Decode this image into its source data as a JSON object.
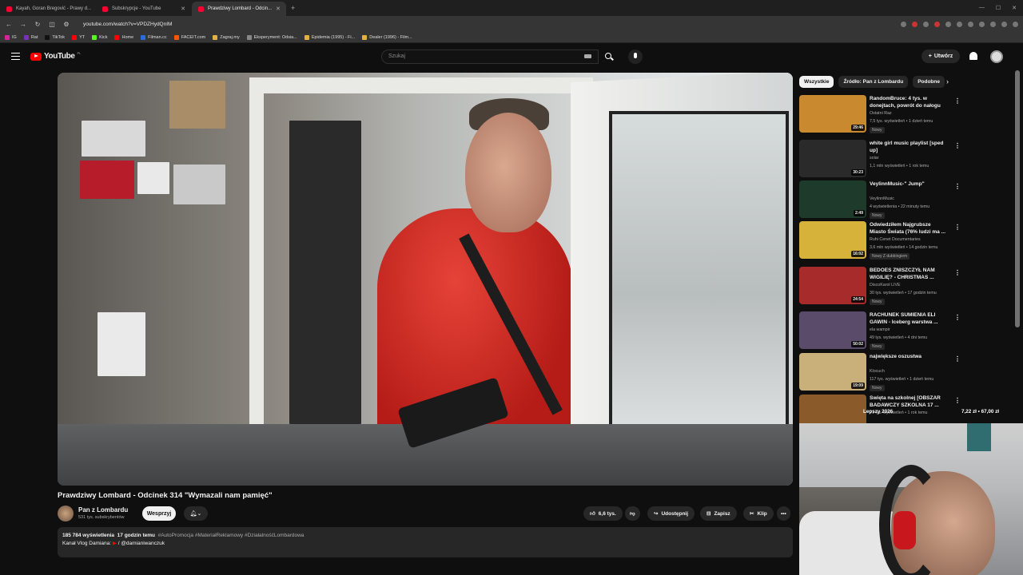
{
  "browser": {
    "tabs": [
      {
        "label": "Kayah, Goran Bregović - Prawy d...",
        "active": false
      },
      {
        "label": "Subskrypcje - YouTube",
        "active": false
      },
      {
        "label": "Prawdziwy Lombard - Odcin...",
        "active": true
      }
    ],
    "url": "youtube.com/watch?v=VPDZHydQnIM",
    "bookmarks": [
      "IG",
      "Rat",
      "TikTok",
      "YT",
      "Kick",
      "Home",
      "Filman.cc",
      "FACEIT.com",
      "Zagraj.my",
      "Eksperyment: Odsia...",
      "Epidemia (1995) - Fi...",
      "Dealer (1996) - Film..."
    ]
  },
  "header": {
    "logo_text": "YouTube",
    "logo_country": "PL",
    "search_placeholder": "Szukaj",
    "create_label": "Utwórz"
  },
  "video": {
    "title": "Prawdziwy Lombard - Odcinek 314 \"Wymazali nam pamięć\"",
    "channel": "Pan z Lombardu",
    "subscribers": "531 tys. subskrybentów",
    "support_label": "Wesprzyj",
    "likes": "6,6 tys.",
    "share_label": "Udostępnij",
    "save_label": "Zapisz",
    "clip_label": "Klip",
    "views": "185 784 wyświetlenia",
    "time_ago": "17 godzin temu",
    "hashtags": "#AutoPromocja #MateriałReklamowy #DziałalnośćLombardowa",
    "desc_line2_prefix": "Kanał Vlog Damiana:",
    "desc_line2_handle": "/ @damianiwanczuk"
  },
  "sidebar": {
    "chips": [
      "Wszystkie",
      "Źródło: Pan z Lombardu",
      "Podobne"
    ],
    "recommendations": [
      {
        "title": "RandomBruce: 4 tys. w donejtach, powrót do nałogu",
        "channel": "Ostatni Raz",
        "meta": "7,5 tys. wyświetleń • 1 dzień temu",
        "badge": "Nowy",
        "duration": "29:46",
        "thumb_color": "#c98a2f"
      },
      {
        "title": "white girl music playlist [sped up]",
        "channel": "solar",
        "meta": "1,1 mln wyświetleń • 1 rok temu",
        "badge": "",
        "duration": "30:23",
        "thumb_color": "#2a2a2a"
      },
      {
        "title": "VeylinnMusic-\" Jump\"",
        "channel": "VeylinnMusic",
        "meta": "4 wyświetlenia • 22 minuty temu",
        "badge": "Nowy",
        "duration": "2:49",
        "thumb_color": "#1e3a2a"
      },
      {
        "title": "Odwiedziłem Najgrubsze Miasto Świata (76% ludzi ma ...",
        "channel": "Ruhi Cenet Documentaries",
        "meta": "3,6 mln wyświetleń • 14 godzin temu",
        "badge": "Nowy  Z dubbingiem",
        "duration": "16:02",
        "thumb_color": "#d6b23a"
      },
      {
        "title": "BEDOES ZNISZCZYŁ NAM WIGILIĘ? - CHRISTMAS ...",
        "channel": "DiscoKarol LIVE",
        "meta": "30 tys. wyświetleń • 17 godzin temu",
        "badge": "Nowy",
        "duration": "24:54",
        "thumb_color": "#a82b2b"
      },
      {
        "title": "RACHUNEK SUMIENIA ELI GAWIN - Iceberg warstwa ...",
        "channel": "ela wampir",
        "meta": "49 tys. wyświetleń • 4 dni temu",
        "badge": "Nowy",
        "duration": "50:02",
        "thumb_color": "#5a4b6b"
      },
      {
        "title": "największe oszustwa",
        "channel": "Klocuch",
        "meta": "117 tys. wyświetleń • 1 dzień temu",
        "badge": "Nowy",
        "duration": "19:09",
        "thumb_color": "#c9b07a"
      },
      {
        "title": "Święta na szkolnej [OBSZAR BADAWCZY SZKOLNA 17 ...",
        "channel": "",
        "meta": "21 tys. wyświetleń • 1 rok temu",
        "badge": "",
        "duration": "",
        "thumb_color": "#8a5a2a"
      }
    ]
  },
  "overlay": {
    "left_text": "Lepszy 2026",
    "right_text": "7,22 zł • 67,00 zł"
  },
  "colors": {
    "background": "#0f0f0f",
    "accent": "#ff0000",
    "pill": "#272727"
  }
}
